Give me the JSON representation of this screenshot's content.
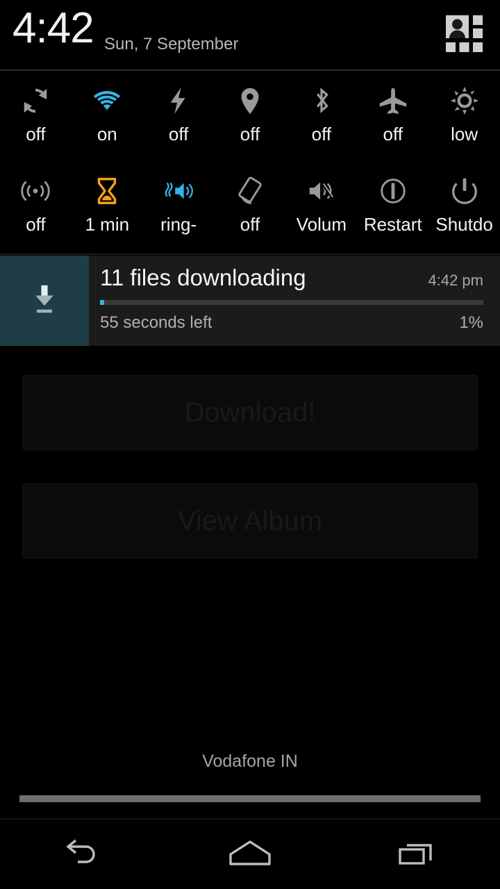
{
  "statusbar": {
    "time": "4:42",
    "date": "Sun, 7 September",
    "profile_icon": "user-tiles-icon"
  },
  "quick_settings": {
    "rows": [
      [
        {
          "icon": "sync-icon",
          "label": "off",
          "state": "off",
          "color": "#9a9a9a"
        },
        {
          "icon": "wifi-icon",
          "label": "on",
          "state": "on",
          "color": "#33b5e5"
        },
        {
          "icon": "flash-icon",
          "label": "off",
          "state": "off",
          "color": "#9a9a9a"
        },
        {
          "icon": "location-icon",
          "label": "off",
          "state": "off",
          "color": "#9a9a9a"
        },
        {
          "icon": "bluetooth-icon",
          "label": "off",
          "state": "off",
          "color": "#9a9a9a"
        },
        {
          "icon": "airplane-icon",
          "label": "off",
          "state": "off",
          "color": "#9a9a9a"
        },
        {
          "icon": "brightness-icon",
          "label": "low",
          "state": "low",
          "color": "#9a9a9a"
        }
      ],
      [
        {
          "icon": "hotspot-icon",
          "label": "off",
          "state": "off",
          "color": "#9a9a9a"
        },
        {
          "icon": "hourglass-icon",
          "label": "1 min",
          "state": "1 min",
          "color": "#f5a019"
        },
        {
          "icon": "ringer-vibrate-icon",
          "label": "ring-",
          "state": "ring-",
          "color": "#33b5e5"
        },
        {
          "icon": "rotation-lock-icon",
          "label": "off",
          "state": "off",
          "color": "#9a9a9a"
        },
        {
          "icon": "volume-icon",
          "label": "Volum",
          "state": "",
          "color": "#9a9a9a"
        },
        {
          "icon": "restart-icon",
          "label": "Restart",
          "state": "",
          "color": "#9a9a9a"
        },
        {
          "icon": "shutdown-icon",
          "label": "Shutdo",
          "state": "",
          "color": "#9a9a9a"
        }
      ]
    ]
  },
  "notification": {
    "icon": "download-icon",
    "title": "11 files downloading",
    "time": "4:42 pm",
    "subtitle": "55 seconds left",
    "percent_label": "1%",
    "progress_percent": 1,
    "accent_color": "#33b5e5",
    "icon_panel_color": "#1e3d47"
  },
  "background_app": {
    "buttons": [
      {
        "label": "Download!"
      },
      {
        "label": "View Album"
      }
    ]
  },
  "footer": {
    "carrier": "Vodafone IN"
  },
  "navbar": {
    "buttons": [
      {
        "icon": "back-icon",
        "label": "Back"
      },
      {
        "icon": "home-icon",
        "label": "Home"
      },
      {
        "icon": "recents-icon",
        "label": "Recents"
      }
    ]
  }
}
